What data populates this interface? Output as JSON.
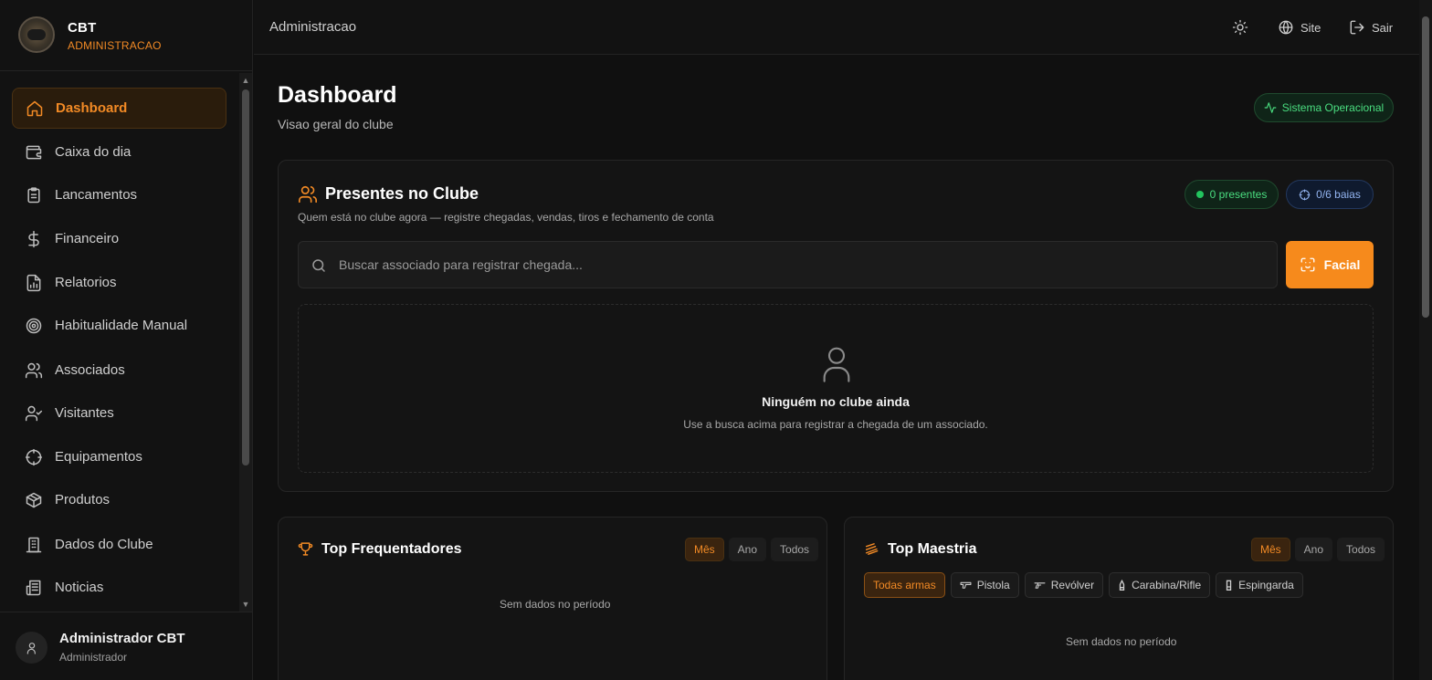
{
  "brand": {
    "name": "CBT",
    "subtitle": "ADMINISTRACAO"
  },
  "sidebar": {
    "items": [
      {
        "label": "Dashboard",
        "icon": "home-icon",
        "active": true
      },
      {
        "label": "Caixa do dia",
        "icon": "wallet-icon"
      },
      {
        "label": "Lancamentos",
        "icon": "clipboard-list-icon"
      },
      {
        "label": "Financeiro",
        "icon": "dollar-icon"
      },
      {
        "label": "Relatorios",
        "icon": "report-chart-icon"
      },
      {
        "label": "Habitualidade Manual",
        "icon": "target-icon"
      },
      {
        "label": "Associados",
        "icon": "users-icon"
      },
      {
        "label": "Visitantes",
        "icon": "user-check-icon"
      },
      {
        "label": "Equipamentos",
        "icon": "crosshair-icon"
      },
      {
        "label": "Produtos",
        "icon": "package-icon"
      },
      {
        "label": "Dados do Clube",
        "icon": "building-icon"
      },
      {
        "label": "Noticias",
        "icon": "newspaper-icon"
      }
    ]
  },
  "user": {
    "name": "Administrador CBT",
    "role": "Administrador"
  },
  "topbar": {
    "title": "Administracao",
    "site_label": "Site",
    "logout_label": "Sair"
  },
  "page": {
    "title": "Dashboard",
    "subtitle": "Visao geral do clube",
    "status": "Sistema Operacional"
  },
  "presentes": {
    "title": "Presentes no Clube",
    "subtitle": "Quem está no clube agora — registre chegadas, vendas, tiros e fechamento de conta",
    "present_count": "0 presentes",
    "bays": "0/6 baias",
    "search_placeholder": "Buscar associado para registrar chegada...",
    "facial_label": "Facial",
    "empty_title": "Ninguém no clube ainda",
    "empty_sub": "Use a busca acima para registrar a chegada de um associado."
  },
  "top_frequentadores": {
    "title": "Top Frequentadores",
    "periods": [
      "Mês",
      "Ano",
      "Todos"
    ],
    "selected_period": "Mês",
    "empty": "Sem dados no período"
  },
  "top_maestria": {
    "title": "Top Maestria",
    "periods": [
      "Mês",
      "Ano",
      "Todos"
    ],
    "selected_period": "Mês",
    "weapons": [
      "Todas armas",
      "Pistola",
      "Revólver",
      "Carabina/Rifle",
      "Espingarda"
    ],
    "selected_weapon": "Todas armas",
    "empty": "Sem dados no período"
  },
  "colors": {
    "accent": "#f68a1c",
    "success": "#4ade80",
    "info": "#93b4f0",
    "bg": "#101010"
  }
}
